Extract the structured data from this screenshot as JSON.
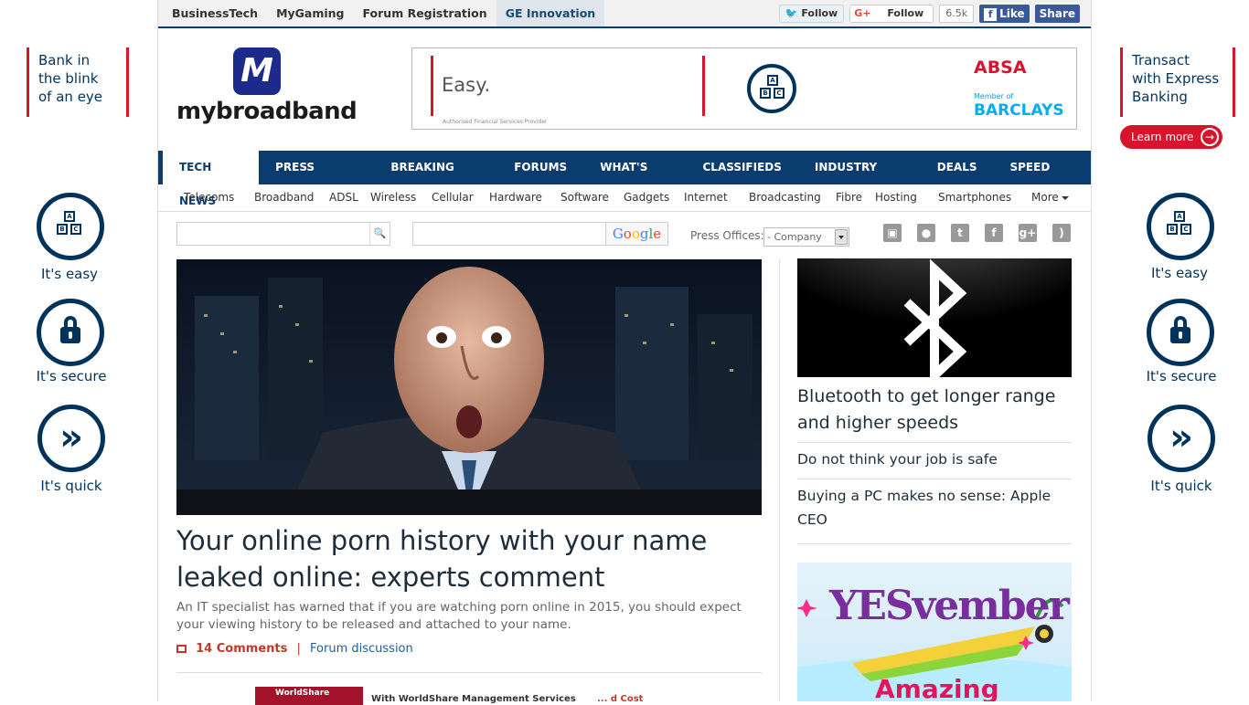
{
  "side_ads": {
    "left": {
      "tagline": [
        "Bank in",
        "the blink",
        "of an eye"
      ],
      "badges": [
        "It's easy",
        "It's secure",
        "It's quick"
      ]
    },
    "right": {
      "tagline": [
        "Transact",
        "with Express",
        "Banking"
      ],
      "cta": "Learn more",
      "badges": [
        "It's easy",
        "It's secure",
        "It's quick"
      ]
    }
  },
  "topbar": {
    "links": [
      "BusinessTech",
      "MyGaming",
      "Forum Registration",
      "GE Innovation"
    ],
    "twitter_follow": "Follow",
    "gplus_follow": "Follow",
    "gplus_count": "6.5k",
    "fb_like": "Like",
    "fb_share": "Share"
  },
  "logo": {
    "text": "mybroadband"
  },
  "banner_ad": {
    "tagline": "Easy.",
    "fine_print": "Authorised Financial Services Provider",
    "brand": "ABSA",
    "member_of": "Member of",
    "partner": "BARCLAYS"
  },
  "main_nav": [
    "TECH NEWS",
    "PRESS OFFICES",
    "BREAKING NEWS",
    "FORUMS",
    "WHAT'S NEW",
    "CLASSIFIEDS",
    "INDUSTRY NEWS",
    "DEALS",
    "SPEED TEST"
  ],
  "sub_nav": [
    "Telecoms",
    "Broadband",
    "ADSL",
    "Wireless",
    "Cellular",
    "Hardware",
    "Software",
    "Gadgets",
    "Internet",
    "Broadcasting",
    "Fibre",
    "Hosting",
    "Smartphones",
    "More"
  ],
  "search": {
    "site_placeholder": "",
    "google_label": "Google",
    "press_offices_label": "Press Offices:",
    "press_offices_selected": "- Company"
  },
  "social_icons": [
    "android-icon",
    "apple-icon",
    "twitter-icon",
    "facebook-icon",
    "google-plus-icon",
    "rss-icon"
  ],
  "lead_story": {
    "headline": "Your online porn history with your name leaked online: experts comment",
    "summary": "An IT specialist has warned that if you are watching porn online in 2015, you should expect your viewing history to be released and attached to your name.",
    "comments": "14 Comments",
    "separator": "|",
    "forum_link": "Forum discussion"
  },
  "sponsored": {
    "brand": "WorldShare",
    "text": "With WorldShare Management Services",
    "red_text": "... d Cost"
  },
  "sidebar": {
    "feature_headline": "Bluetooth to get longer range and higher speeds",
    "headlines": [
      "Do not think your job is safe",
      "Buying a PC makes no sense: Apple CEO"
    ],
    "ad_title": "YESvember",
    "ad_subtitle": "Amazing"
  },
  "colors": {
    "nav_blue": "#0b3c70",
    "absa_red": "#d7142b",
    "absa_navy": "#00335b",
    "link_blue": "#1b5ea3",
    "comment_red": "#c0392b"
  }
}
